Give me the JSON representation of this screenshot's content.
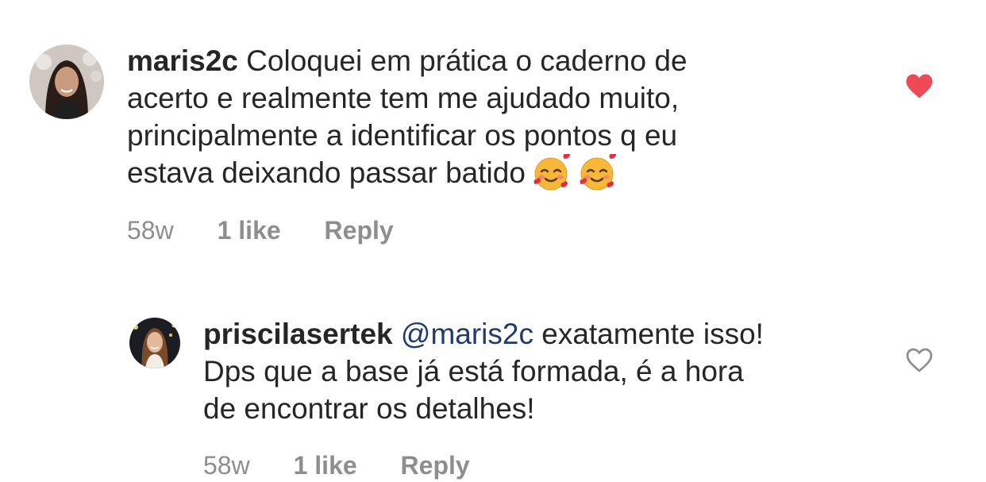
{
  "comments": [
    {
      "username": "maris2c",
      "lines": [
        "Coloquei em prática o caderno de",
        "acerto e realmente tem me ajudado muito,",
        "principalmente a identificar os pontos q eu",
        "estava deixando passar batido"
      ],
      "emojis": [
        "smiling-face-with-hearts",
        "smiling-face-with-hearts"
      ],
      "time": "58w",
      "likes": "1 like",
      "reply": "Reply",
      "liked": true,
      "heart_color": "#ed4956"
    },
    {
      "username": "priscilasertek",
      "mention": "@maris2c",
      "lines": [
        "exatamente isso!",
        "Dps que a base já está formada, é a hora",
        "de encontrar os detalhes!"
      ],
      "time": "58w",
      "likes": "1 like",
      "reply": "Reply",
      "liked": false,
      "heart_color": "#8e8e8e"
    }
  ],
  "colors": {
    "text": "#262626",
    "secondary": "#8e8e8e",
    "mention": "#1f3a6b",
    "like": "#ed4956"
  }
}
